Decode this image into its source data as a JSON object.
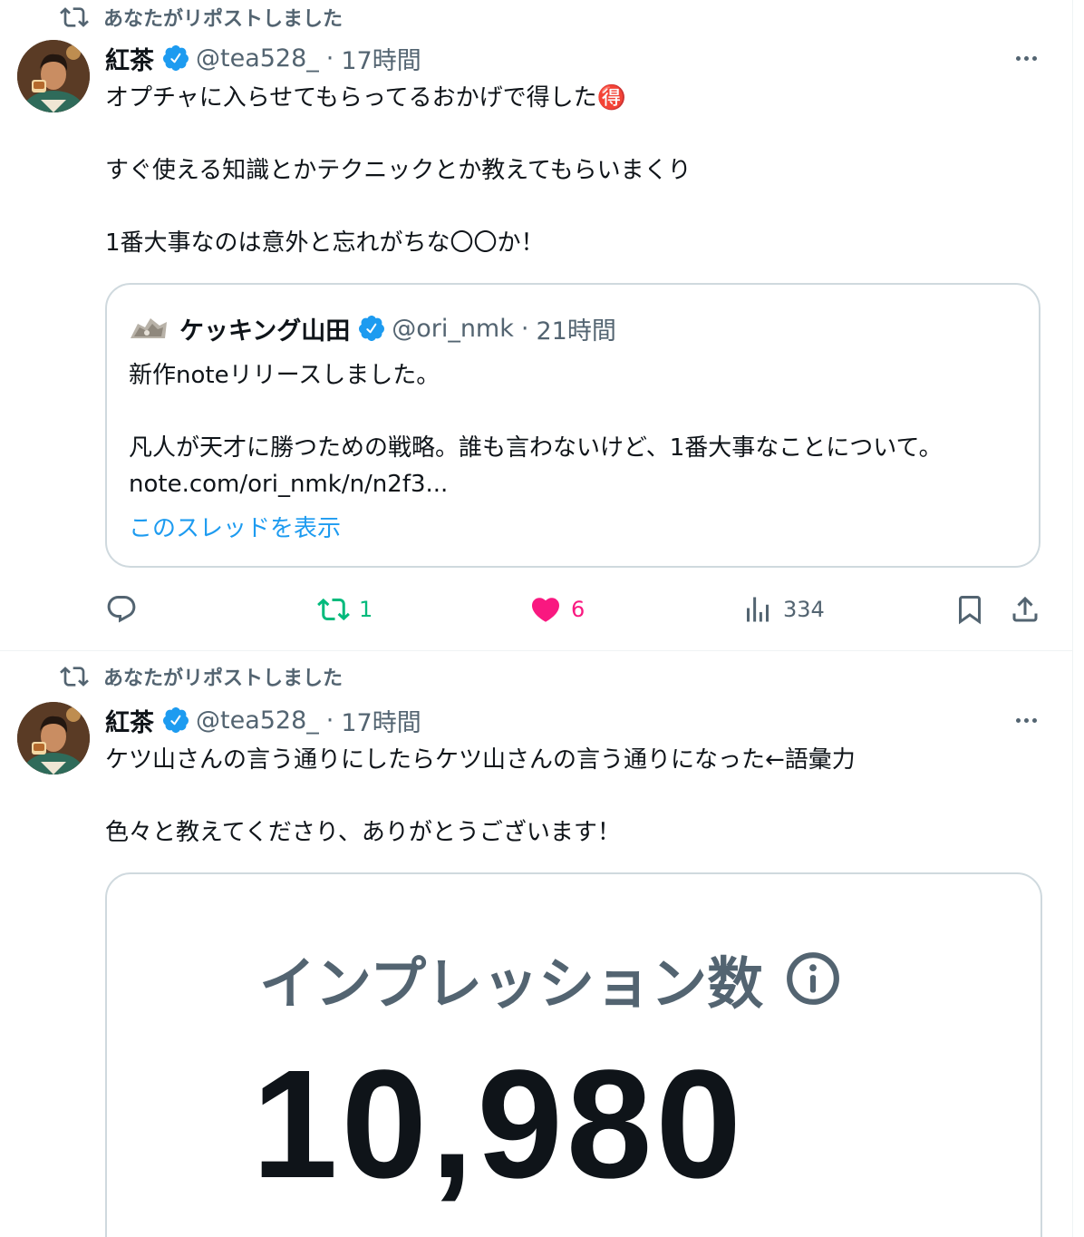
{
  "colors": {
    "text_primary": "#0f1419",
    "text_secondary": "#536471",
    "link_blue": "#1d9bf0",
    "verified_blue": "#1d9bf0",
    "repost_green": "#00ba7c",
    "like_pink": "#f91880",
    "border": "#cfd9de"
  },
  "tweets": [
    {
      "social_context": "あなたがリポストしました",
      "author": {
        "display_name": "紅茶",
        "handle": "@tea528_",
        "time": "17時間",
        "verified": true
      },
      "text_lines": [
        "オプチャに入らせてもらってるおかげで得した",
        "すぐ使える知識とかテクニックとか教えてもらいまくり",
        "1番大事なのは意外と忘れがちな〇〇か！"
      ],
      "emoji": "🉐",
      "quote": {
        "author": {
          "display_name": "ケッキング山田",
          "handle": "@ori_nmk",
          "time": "21時間",
          "verified": true
        },
        "text_lines": [
          "新作noteリリースしました。",
          "凡人が天才に勝つための戦略。誰も言わないけど、1番大事なことについて。",
          "note.com/ori_nmk/n/n2f3..."
        ],
        "show_thread": "このスレッドを表示"
      },
      "actions": {
        "replies": "",
        "reposts": "1",
        "likes": "6",
        "views": "334",
        "reposted": true,
        "liked": true
      }
    },
    {
      "social_context": "あなたがリポストしました",
      "author": {
        "display_name": "紅茶",
        "handle": "@tea528_",
        "time": "17時間",
        "verified": true
      },
      "text_lines": [
        "ケツ山さんの言う通りにしたらケツ山さんの言う通りになった←語彙力",
        "色々と教えてくださり、ありがとうございます！"
      ],
      "media": {
        "title": "インプレッション数",
        "value": "10,980",
        "icon": "info-icon"
      }
    }
  ]
}
